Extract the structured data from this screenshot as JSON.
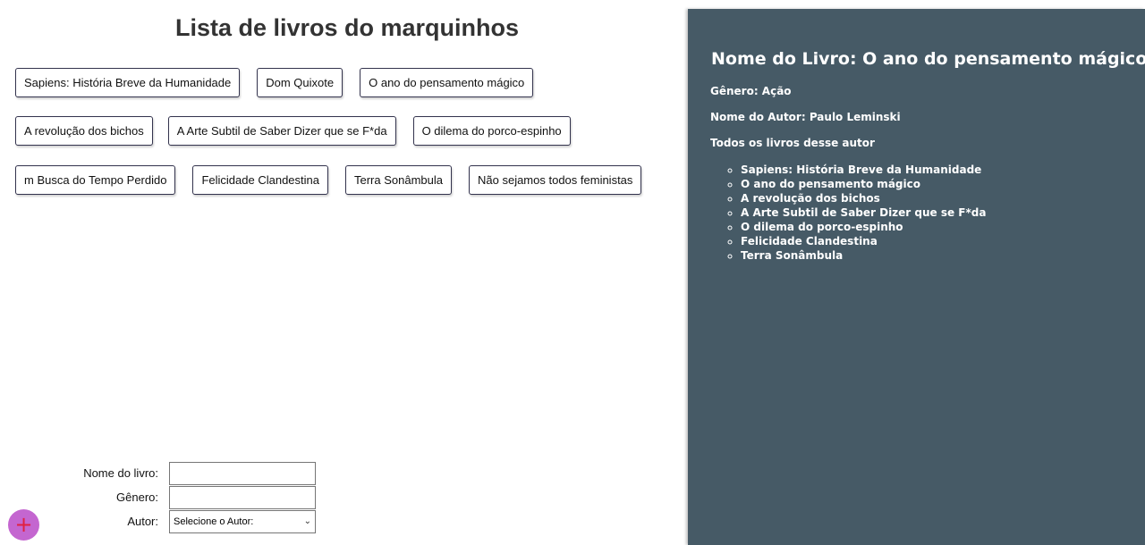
{
  "page_title": "Lista de livros do marquinhos",
  "books": {
    "row1": [
      "Sapiens: História Breve da Humanidade",
      "Dom Quixote",
      "O ano do pensamento mágico"
    ],
    "row2": [
      "A revolução dos bichos",
      "A Arte Subtil de Saber Dizer que se F*da",
      "O dilema do porco-espinho"
    ],
    "row3": [
      "m Busca do Tempo Perdido",
      "Felicidade Clandestina",
      "Terra Sonâmbula",
      "Não sejamos todos feministas"
    ]
  },
  "form": {
    "book_name_label": "Nome do livro:",
    "book_name_value": "",
    "genre_label": "Gênero:",
    "genre_value": "",
    "author_label": "Autor:",
    "author_selected": "Selecione o Autor:"
  },
  "fab_icon": "plus-icon",
  "fab_symbol": "+",
  "detail": {
    "title": "Nome do Livro: O ano do pensamento mágico",
    "genre": "Gênero: Ação",
    "author": "Nome do Autor: Paulo Leminski",
    "books_heading": "Todos os livros desse autor",
    "author_books": [
      "Sapiens: História Breve da Humanidade",
      "O ano do pensamento mágico",
      "A revolução dos bichos",
      "A Arte Subtil de Saber Dizer que se F*da",
      "O dilema do porco-espinho",
      "Felicidade Clandestina",
      "Terra Sonâmbula"
    ]
  },
  "colors": {
    "detail_panel_bg": "#465a66",
    "fab_bg": "#c466d0",
    "fab_symbol": "#e02040"
  }
}
